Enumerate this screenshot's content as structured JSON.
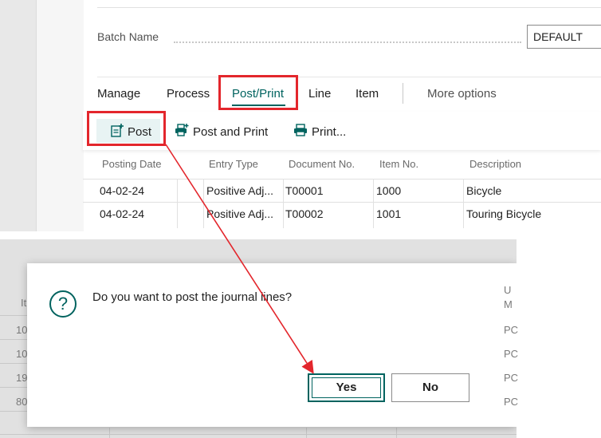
{
  "batch": {
    "label": "Batch Name",
    "value": "DEFAULT"
  },
  "menu": {
    "tabs": [
      {
        "label": "Manage"
      },
      {
        "label": "Process"
      },
      {
        "label": "Post/Print"
      },
      {
        "label": "Line"
      },
      {
        "label": "Item"
      }
    ],
    "more_options": "More options",
    "selected": "Post/Print"
  },
  "actions": {
    "post": "Post",
    "post_and_print": "Post and Print",
    "print": "Print..."
  },
  "grid": {
    "columns": [
      "Posting Date",
      "Entry Type",
      "Document No.",
      "Item No.",
      "Description"
    ],
    "rows": [
      {
        "posting_date": "04-02-24",
        "entry_type": "Positive Adj...",
        "document_no": "T00001",
        "item_no": "1000",
        "description": "Bicycle"
      },
      {
        "posting_date": "04-02-24",
        "entry_type": "Positive Adj...",
        "document_no": "T00002",
        "item_no": "1001",
        "description": "Touring Bicycle"
      }
    ]
  },
  "background_grid": {
    "left_header": "It",
    "left_cells": [
      "10",
      "10",
      "19",
      "80"
    ],
    "right_header_1": "U",
    "right_header_2": "M",
    "right_cells": [
      "PC",
      "PC",
      "PC",
      "PC"
    ]
  },
  "dialog": {
    "message": "Do you want to post the journal lines?",
    "yes": "Yes",
    "no": "No"
  },
  "colors": {
    "accent": "#00635f",
    "highlight_box": "#e3262c",
    "arrow": "#e3262c"
  }
}
